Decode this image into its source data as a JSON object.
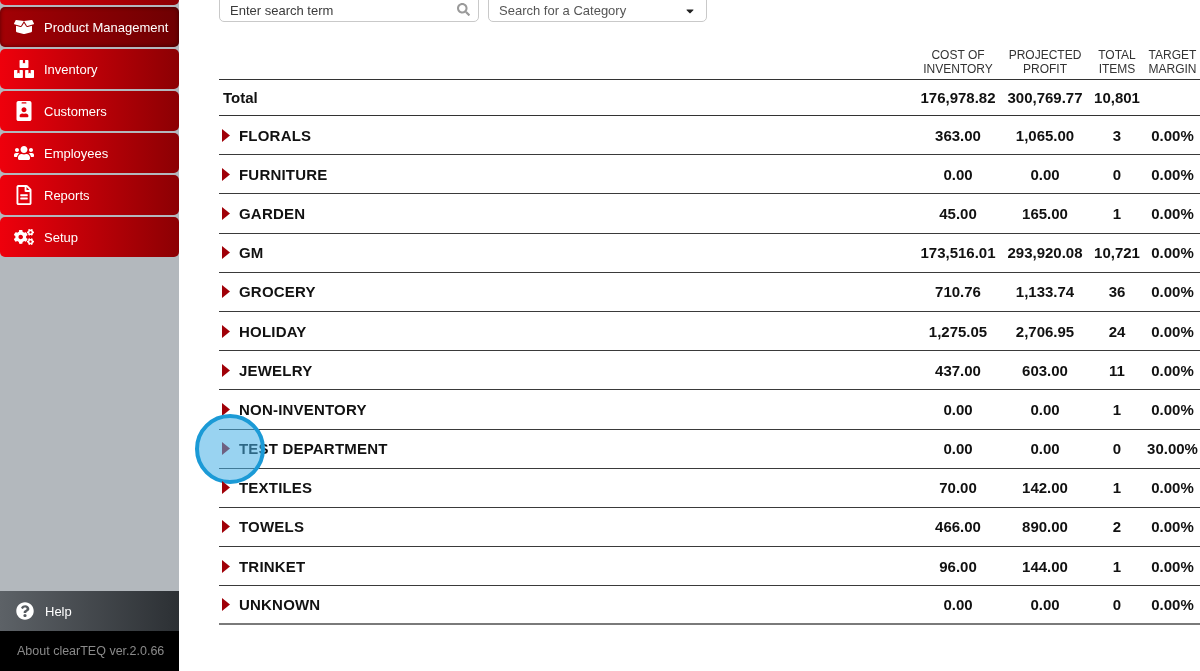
{
  "sidebar": {
    "items": [
      {
        "label": "Product Management",
        "selected": true
      },
      {
        "label": "Inventory",
        "selected": false
      },
      {
        "label": "Customers",
        "selected": false
      },
      {
        "label": "Employees",
        "selected": false
      },
      {
        "label": "Reports",
        "selected": false
      },
      {
        "label": "Setup",
        "selected": false
      }
    ],
    "help": {
      "label": "Help"
    },
    "about": {
      "text": "About clearTEQ ver.2.0.66"
    }
  },
  "toolbar": {
    "search": {
      "placeholder": "Enter search term"
    },
    "category": {
      "placeholder": "Search for a Category"
    }
  },
  "table": {
    "columns": [
      {
        "label": "COST OF INVENTORY"
      },
      {
        "label": "PROJECTED PROFIT"
      },
      {
        "label": "TOTAL ITEMS"
      },
      {
        "label": "TARGET MARGIN"
      }
    ],
    "total": {
      "label": "Total",
      "cells": [
        "176,978.82",
        "300,769.77",
        "10,801"
      ]
    },
    "rows": [
      {
        "name": "FLORALS",
        "expanded": false,
        "click_marker": false,
        "cells": [
          "363.00",
          "1,065.00",
          "3",
          "0.00%"
        ]
      },
      {
        "name": "FURNITURE",
        "expanded": false,
        "click_marker": false,
        "cells": [
          "0.00",
          "0.00",
          "0",
          "0.00%"
        ]
      },
      {
        "name": "GARDEN",
        "expanded": false,
        "click_marker": false,
        "cells": [
          "45.00",
          "165.00",
          "1",
          "0.00%"
        ]
      },
      {
        "name": "GM",
        "expanded": false,
        "click_marker": false,
        "cells": [
          "173,516.01",
          "293,920.08",
          "10,721",
          "0.00%"
        ]
      },
      {
        "name": "GROCERY",
        "expanded": false,
        "click_marker": false,
        "cells": [
          "710.76",
          "1,133.74",
          "36",
          "0.00%"
        ]
      },
      {
        "name": "HOLIDAY",
        "expanded": false,
        "click_marker": false,
        "cells": [
          "1,275.05",
          "2,706.95",
          "24",
          "0.00%"
        ]
      },
      {
        "name": "JEWELRY",
        "expanded": false,
        "click_marker": false,
        "cells": [
          "437.00",
          "603.00",
          "11",
          "0.00%"
        ]
      },
      {
        "name": "NON-INVENTORY",
        "expanded": false,
        "click_marker": false,
        "cells": [
          "0.00",
          "0.00",
          "1",
          "0.00%"
        ]
      },
      {
        "name": "TEST DEPARTMENT",
        "expanded": false,
        "click_marker": true,
        "cells": [
          "0.00",
          "0.00",
          "0",
          "30.00%"
        ]
      },
      {
        "name": "TEXTILES",
        "expanded": false,
        "click_marker": false,
        "cells": [
          "70.00",
          "142.00",
          "1",
          "0.00%"
        ]
      },
      {
        "name": "TOWELS",
        "expanded": false,
        "click_marker": false,
        "cells": [
          "466.00",
          "890.00",
          "2",
          "0.00%"
        ]
      },
      {
        "name": "TRINKET",
        "expanded": false,
        "click_marker": false,
        "cells": [
          "96.00",
          "144.00",
          "1",
          "0.00%"
        ]
      },
      {
        "name": "UNKNOWN",
        "expanded": false,
        "click_marker": false,
        "cells": [
          "0.00",
          "0.00",
          "0",
          "0.00%"
        ]
      }
    ]
  }
}
